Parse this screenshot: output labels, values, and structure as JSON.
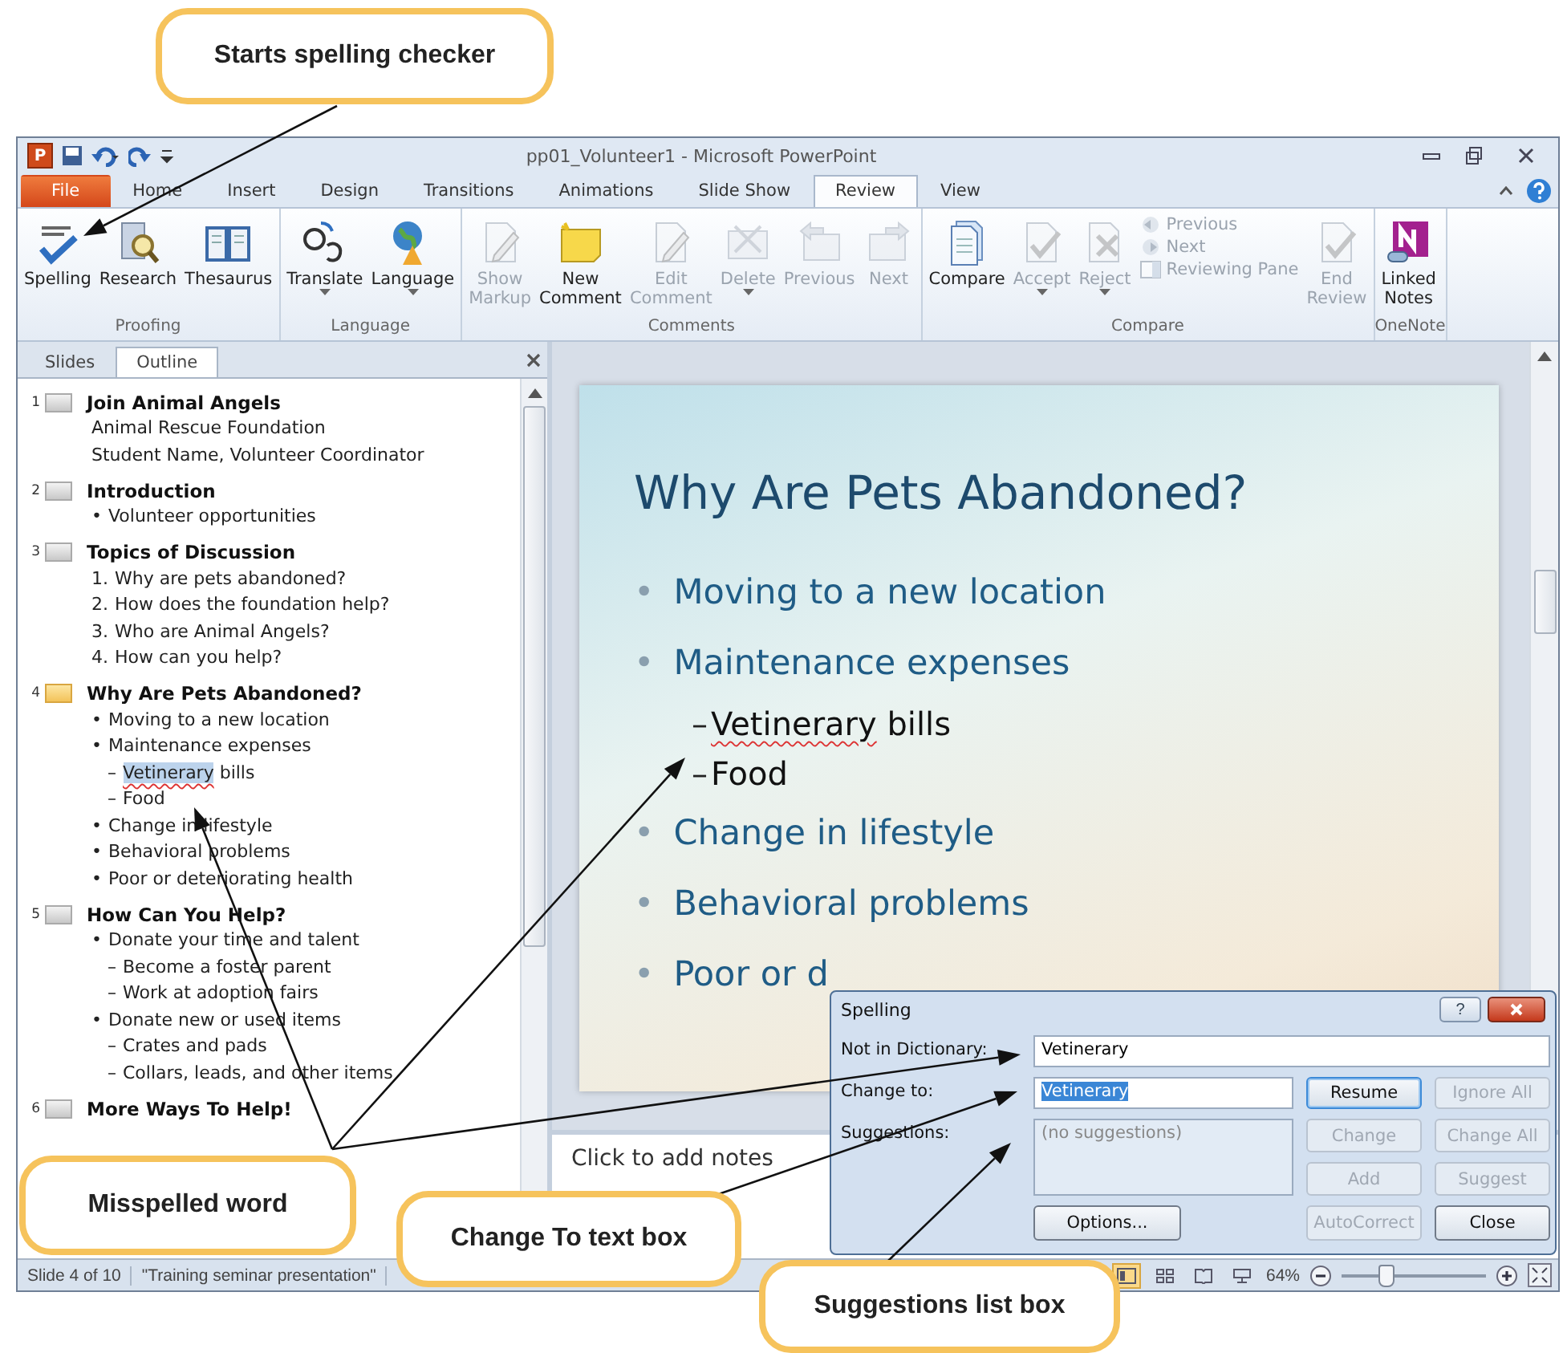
{
  "window": {
    "title": "pp01_Volunteer1 - Microsoft PowerPoint",
    "app_logo": "P"
  },
  "tabs": [
    {
      "label": "File",
      "kind": "file",
      "selected": false
    },
    {
      "label": "Home",
      "kind": "tab",
      "selected": false
    },
    {
      "label": "Insert",
      "kind": "tab",
      "selected": false
    },
    {
      "label": "Design",
      "kind": "tab",
      "selected": false
    },
    {
      "label": "Transitions",
      "kind": "tab",
      "selected": false
    },
    {
      "label": "Animations",
      "kind": "tab",
      "selected": false
    },
    {
      "label": "Slide Show",
      "kind": "tab",
      "selected": false
    },
    {
      "label": "Review",
      "kind": "tab",
      "selected": true
    },
    {
      "label": "View",
      "kind": "tab",
      "selected": false
    }
  ],
  "ribbon": {
    "groups": [
      {
        "name": "Proofing",
        "buttons": [
          {
            "kind": "large",
            "lines": [
              "Spelling"
            ],
            "disabled": false,
            "dropdown": false
          },
          {
            "kind": "large",
            "lines": [
              "Research"
            ],
            "disabled": false,
            "dropdown": false
          },
          {
            "kind": "large",
            "lines": [
              "Thesaurus"
            ],
            "disabled": false,
            "dropdown": false
          }
        ]
      },
      {
        "name": "Language",
        "buttons": [
          {
            "kind": "large",
            "lines": [
              "Translate"
            ],
            "disabled": false,
            "dropdown": true
          },
          {
            "kind": "large",
            "lines": [
              "Language"
            ],
            "disabled": false,
            "dropdown": true
          }
        ]
      },
      {
        "name": "Comments",
        "buttons": [
          {
            "kind": "large",
            "lines": [
              "Show",
              "Markup"
            ],
            "disabled": true,
            "dropdown": false
          },
          {
            "kind": "large",
            "lines": [
              "New",
              "Comment"
            ],
            "disabled": false,
            "dropdown": false
          },
          {
            "kind": "large",
            "lines": [
              "Edit",
              "Comment"
            ],
            "disabled": true,
            "dropdown": false
          },
          {
            "kind": "large",
            "lines": [
              "Delete"
            ],
            "disabled": true,
            "dropdown": true
          },
          {
            "kind": "large",
            "lines": [
              "Previous"
            ],
            "disabled": true,
            "dropdown": false
          },
          {
            "kind": "large",
            "lines": [
              "Next"
            ],
            "disabled": true,
            "dropdown": false
          }
        ]
      },
      {
        "name": "Compare",
        "buttons": [
          {
            "kind": "large",
            "lines": [
              "Compare"
            ],
            "disabled": false,
            "dropdown": false
          },
          {
            "kind": "large",
            "lines": [
              "Accept"
            ],
            "disabled": true,
            "dropdown": true
          },
          {
            "kind": "large",
            "lines": [
              "Reject"
            ],
            "disabled": true,
            "dropdown": true
          },
          {
            "kind": "stack",
            "items": [
              {
                "label": "Previous",
                "disabled": true
              },
              {
                "label": "Next",
                "disabled": true
              },
              {
                "label": "Reviewing Pane",
                "disabled": true
              }
            ]
          },
          {
            "kind": "large",
            "lines": [
              "End",
              "Review"
            ],
            "disabled": true,
            "dropdown": false
          }
        ]
      },
      {
        "name": "OneNote",
        "buttons": [
          {
            "kind": "large",
            "lines": [
              "Linked",
              "Notes"
            ],
            "disabled": false,
            "dropdown": false
          }
        ]
      }
    ]
  },
  "pane": {
    "tabs": [
      {
        "label": "Slides",
        "selected": false
      },
      {
        "label": "Outline",
        "selected": true
      }
    ],
    "outline": [
      {
        "number": "1",
        "title": "Join Animal Angels",
        "selected": false,
        "lines": [
          {
            "text": "Animal Rescue Foundation"
          },
          {
            "text": "Student Name, Volunteer Coordinator"
          }
        ]
      },
      {
        "number": "2",
        "title": "Introduction",
        "selected": false,
        "lines": [
          {
            "marker": "•",
            "text": "Volunteer opportunities"
          }
        ]
      },
      {
        "number": "3",
        "title": "Topics of Discussion",
        "selected": false,
        "lines": [
          {
            "marker": "1.",
            "text": "Why are pets abandoned?"
          },
          {
            "marker": "2.",
            "text": "How does the foundation help?"
          },
          {
            "marker": "3.",
            "text": "Who are Animal Angels?"
          },
          {
            "marker": "4.",
            "text": "How can you help?"
          }
        ]
      },
      {
        "number": "4",
        "title": "Why Are Pets Abandoned?",
        "selected": true,
        "lines": [
          {
            "marker": "•",
            "text": "Moving to a new location"
          },
          {
            "marker": "•",
            "text": "Maintenance expenses",
            "children": [
              {
                "marker": "–",
                "parts": [
                  {
                    "text": "Vetinerary",
                    "misspelled": true
                  },
                  {
                    "text": " bills",
                    "misspelled": false
                  }
                ]
              },
              {
                "marker": "–",
                "text": "Food"
              }
            ]
          },
          {
            "marker": "•",
            "text": "Change in lifestyle"
          },
          {
            "marker": "•",
            "text": "Behavioral problems"
          },
          {
            "marker": "•",
            "text": "Poor or deteriorating health"
          }
        ]
      },
      {
        "number": "5",
        "title": "How Can You Help?",
        "selected": false,
        "lines": [
          {
            "marker": "•",
            "text": "Donate your time and talent",
            "children": [
              {
                "marker": "–",
                "text": "Become a foster parent"
              },
              {
                "marker": "–",
                "text": "Work at adoption fairs"
              }
            ]
          },
          {
            "marker": "•",
            "text": "Donate new or used items",
            "children": [
              {
                "marker": "–",
                "text": "Crates and pads"
              },
              {
                "marker": "–",
                "text": "Collars, leads, and other items"
              }
            ]
          }
        ]
      },
      {
        "number": "6",
        "title": "More Ways To Help!",
        "selected": false
      }
    ]
  },
  "slide": {
    "title": "Why Are Pets Abandoned?",
    "bullets": [
      {
        "marker": "•",
        "text": "Moving to a new location"
      },
      {
        "marker": "•",
        "text": "Maintenance expenses",
        "children": [
          {
            "marker": "–",
            "parts": [
              {
                "text": "Vetinerary",
                "misspelled": true
              },
              {
                "text": " bills",
                "misspelled": false
              }
            ]
          },
          {
            "marker": "–",
            "text": "Food"
          }
        ]
      },
      {
        "marker": "•",
        "text": "Change in lifestyle"
      },
      {
        "marker": "•",
        "text": "Behavioral problems"
      },
      {
        "marker": "•",
        "text": "Poor or d"
      }
    ]
  },
  "notes": {
    "placeholder": "Click to add notes"
  },
  "status_bar": {
    "slide": "Slide 4 of 10",
    "theme": "\"Training seminar presentation\"",
    "views": [
      {
        "selected": true
      },
      {
        "selected": false
      },
      {
        "selected": false
      },
      {
        "selected": false
      }
    ],
    "zoom": "64%",
    "zoom_slider": {
      "level": 0.3
    }
  },
  "dialog": {
    "title": "Spelling",
    "help": "?",
    "not_in_dictionary": {
      "label": "Not in Dictionary:",
      "value": "Vetinerary"
    },
    "change_to": {
      "label": "Change to:",
      "value": "Vetinerary",
      "value_selected": true
    },
    "suggestions": {
      "label": "Suggestions:",
      "placeholder": "(no suggestions)"
    },
    "buttons": [
      {
        "label": "Resume",
        "disabled": false,
        "default": true
      },
      {
        "label": "Ignore All",
        "disabled": true,
        "default": false
      },
      {
        "label": "Change",
        "disabled": true,
        "default": false
      },
      {
        "label": "Change All",
        "disabled": true,
        "default": false
      },
      {
        "label": "Add",
        "disabled": true,
        "default": false
      },
      {
        "label": "Suggest",
        "disabled": true,
        "default": false
      }
    ],
    "options": {
      "label": "Options...",
      "disabled": false
    },
    "bottom_buttons": [
      {
        "label": "AutoCorrect",
        "disabled": true,
        "default": false
      },
      {
        "label": "Close",
        "disabled": false,
        "default": false
      }
    ]
  },
  "callouts": [
    {
      "text": "Starts spelling checker"
    },
    {
      "text": "Misspelled word"
    },
    {
      "text": "Change To text box"
    },
    {
      "text": "Suggestions list box"
    }
  ]
}
